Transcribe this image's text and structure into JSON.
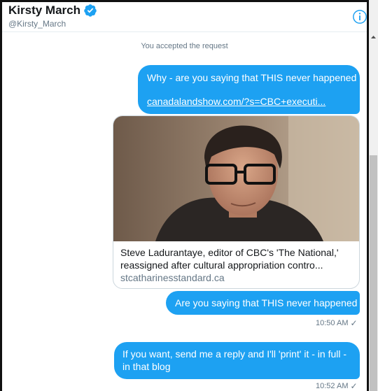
{
  "header": {
    "name": "Kirsty March",
    "handle": "@Kirsty_March",
    "verified_icon": "verified-badge-icon",
    "info_icon": "info-icon"
  },
  "conversation": {
    "system_note": "You accepted the request",
    "message1": {
      "text": "Why - are you saying that THIS never happened",
      "link": "canadalandshow.com/?s=CBC+executi..."
    },
    "card": {
      "image": "photo-of-man-with-glasses",
      "title": "Steve Ladurantaye, editor of CBC's 'The National,' reassigned after cultural appropriation contro...",
      "domain": "stcatharinesstandard.ca"
    },
    "message2": {
      "text": "Are you saying that THIS never happened",
      "time": "10:50 AM"
    },
    "message3": {
      "text": "If you want, send me a reply and I'll 'print' it - in full - in that blog",
      "time": "10:52 AM"
    },
    "check_glyph": "✓"
  },
  "colors": {
    "bubble": "#1da1f2",
    "meta_text": "#657786",
    "verified": "#1da1f2"
  }
}
